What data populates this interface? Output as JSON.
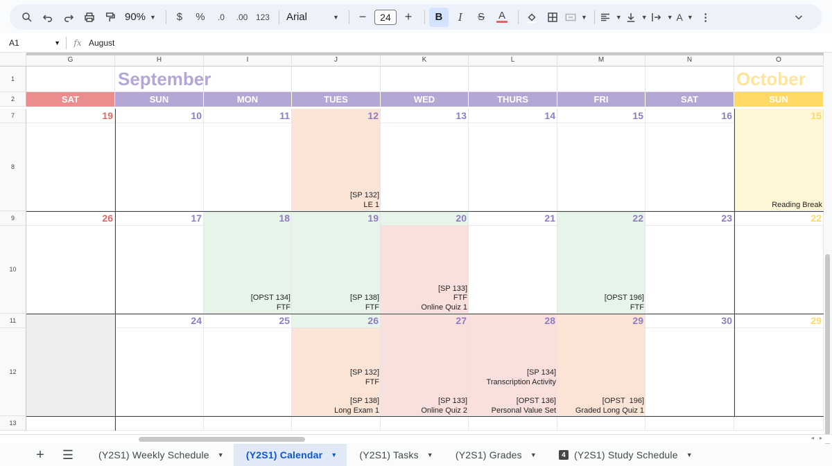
{
  "toolbar": {
    "zoom": "90%",
    "currency": "$",
    "percent": "%",
    "dec_decrease": ".0",
    "dec_increase": ".00",
    "format_123": "123",
    "font": "Arial",
    "font_size": "24"
  },
  "formula_bar": {
    "cell_ref": "A1",
    "fx": "fx",
    "value": "August"
  },
  "columns": [
    "G",
    "H",
    "I",
    "J",
    "K",
    "L",
    "M",
    "N",
    "O"
  ],
  "rows": [
    "1",
    "2",
    "7",
    "8",
    "9",
    "10",
    "11",
    "12",
    "13"
  ],
  "months": {
    "sep": "September",
    "oct": "October"
  },
  "day_headers": [
    "SAT",
    "SUN",
    "MON",
    "TUES",
    "WED",
    "THURS",
    "FRI",
    "SAT",
    "SUN"
  ],
  "week1": [
    "19",
    "10",
    "11",
    "12",
    "13",
    "14",
    "15",
    "16",
    "15"
  ],
  "week2": [
    "26",
    "17",
    "18",
    "19",
    "20",
    "21",
    "22",
    "23",
    "22"
  ],
  "week3": [
    "",
    "24",
    "25",
    "26",
    "27",
    "28",
    "29",
    "30",
    "29"
  ],
  "events": {
    "w1_j": "[SP 132]\nLE 1",
    "w1_o": "Reading Break",
    "w2_i": "[OPST 134]\nFTF",
    "w2_j": "[SP 138]\nFTF",
    "w2_k": "[SP 133]\nFTF\nOnline Quiz 1",
    "w2_m": "[OPST 196]\nFTF",
    "w3_j_top": "[SP 132]\nFTF",
    "w3_j_bot": "[SP 138]\nLong Exam 1",
    "w3_k_bot": "[SP 133]\nOnline Quiz 2",
    "w3_l_top": "[SP 134]\nTranscription Activity",
    "w3_l_bot": "[OPST 136]\nPersonal Value Set",
    "w3_m_bot": "[OPST  196]\nGraded Long Quiz 1"
  },
  "sheet_tabs": [
    {
      "label": "(Y2S1) Weekly Schedule"
    },
    {
      "label": "(Y2S1) Calendar"
    },
    {
      "label": "(Y2S1) Tasks"
    },
    {
      "label": "(Y2S1) Grades"
    },
    {
      "label": "(Y2S1) Study Schedule",
      "badge": "4"
    }
  ],
  "colors": {
    "sat": "#e98d8d",
    "weekday": "#b4a7d6",
    "sun_oct": "#ffd966",
    "peach": "#fbe3d6",
    "green": "#e6f4ea",
    "pink": "#f9e0dd",
    "yellow": "#fff7d6"
  }
}
